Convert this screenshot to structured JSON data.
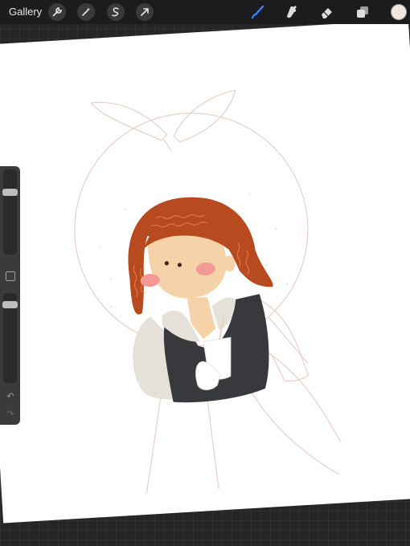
{
  "toolbar": {
    "gallery_label": "Gallery",
    "actions": [
      "wrench-icon",
      "magic-wand-icon",
      "selection-icon",
      "transform-arrow-icon"
    ],
    "tools": [
      "brush-icon",
      "smudge-icon",
      "eraser-icon",
      "layers-icon"
    ],
    "active_tool": "brush-icon",
    "active_tool_color": "#2f8bff",
    "current_color": "#efe7d9"
  },
  "sidebar": {
    "brush_size_level": 0.75,
    "opacity_level": 0.9,
    "undo_icon": "↶",
    "redo_icon": "↷"
  },
  "palette": {
    "hair": "#b84a1f",
    "hair_lines": "#e07a4a",
    "skin": "#f5d2a8",
    "blush": "#f39a96",
    "vest": "#38393d",
    "shirt": "#e6e1d8",
    "sketch": "#e8cfc7"
  }
}
